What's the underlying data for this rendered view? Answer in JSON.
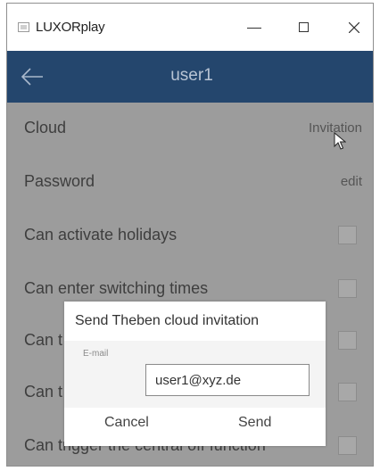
{
  "window": {
    "title": "LUXORplay",
    "minimize_label": "Minimize",
    "maximize_label": "Maximize",
    "close_label": "Close"
  },
  "header": {
    "title": "user1",
    "back_icon": "arrow-left-icon"
  },
  "rows": [
    {
      "label": "Cloud",
      "action": "Invitation"
    },
    {
      "label": "Password",
      "action": "edit"
    },
    {
      "label": "Can activate holidays",
      "checked": false
    },
    {
      "label": "Can enter switching times",
      "checked": false
    },
    {
      "label": "Can t",
      "checked": false
    },
    {
      "label": "Can t",
      "checked": false
    },
    {
      "label": "Can trigger the central off function",
      "checked": false
    }
  ],
  "dialog": {
    "title": "Send Theben cloud invitation",
    "email_label": "E-mail",
    "email_value": "user1@xyz.de",
    "cancel_label": "Cancel",
    "send_label": "Send"
  },
  "colors": {
    "accent": "#24466d",
    "overlay": "#9c9c9c"
  }
}
